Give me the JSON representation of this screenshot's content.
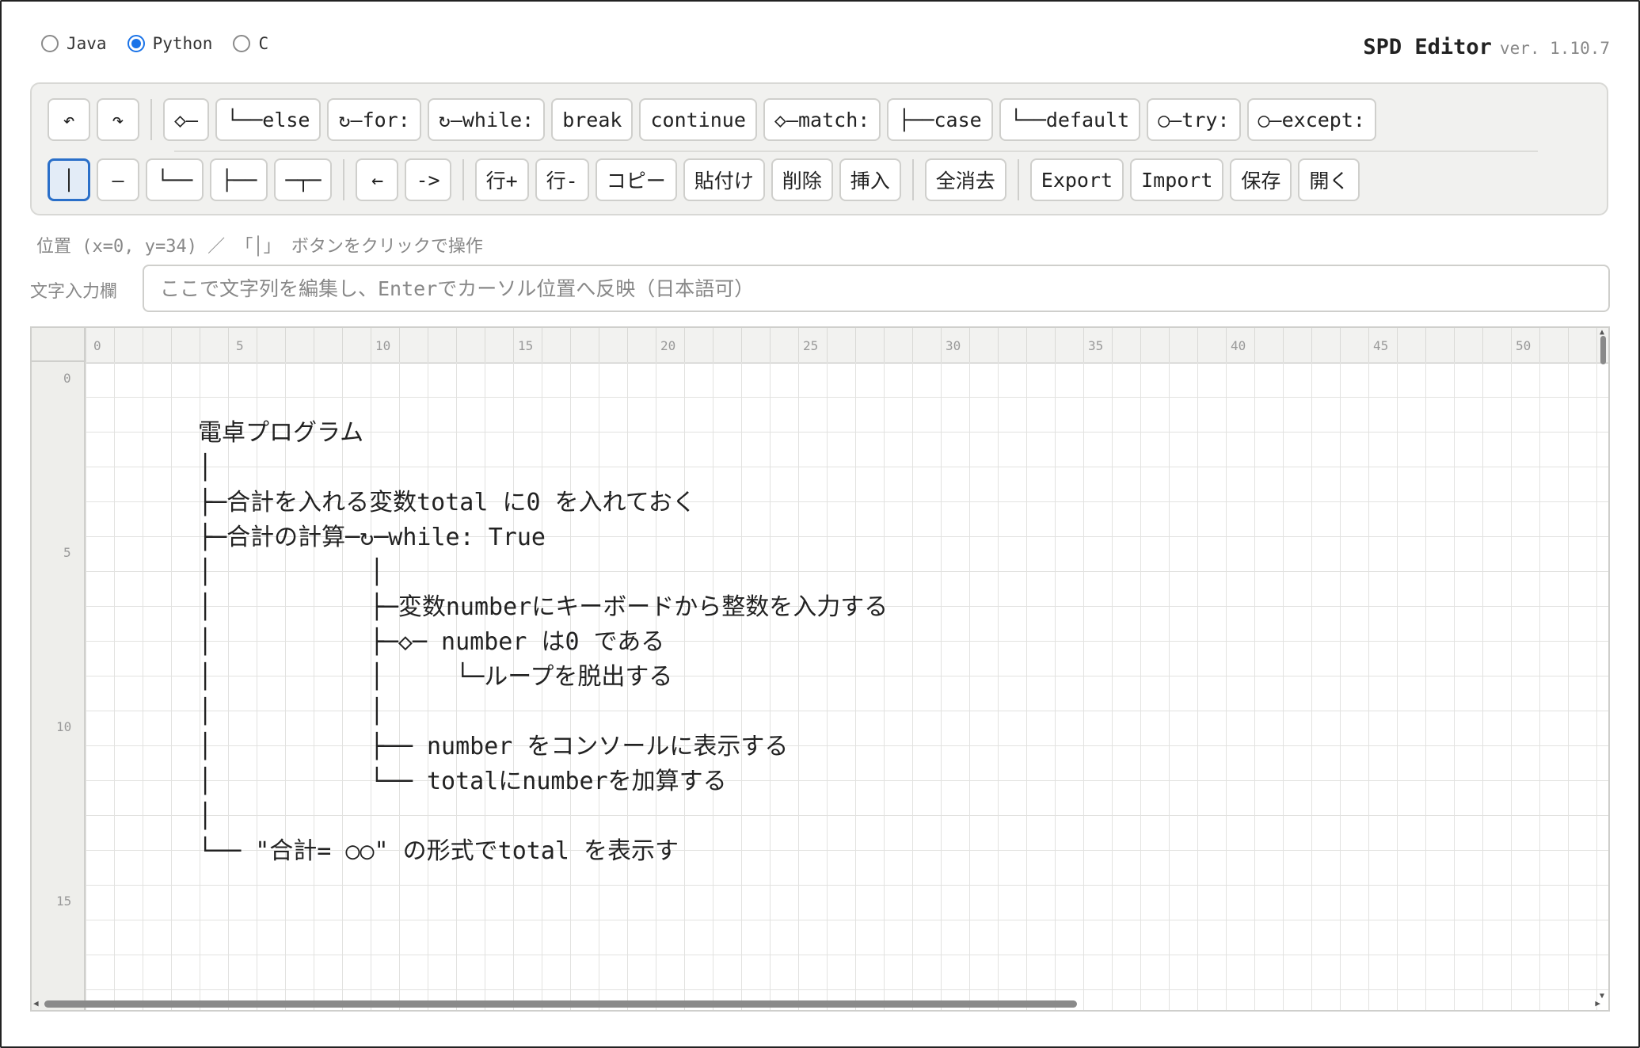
{
  "languages": [
    {
      "label": "Java",
      "selected": false
    },
    {
      "label": "Python",
      "selected": true
    },
    {
      "label": "C",
      "selected": false
    }
  ],
  "app": {
    "title": "SPD Editor",
    "version": "ver. 1.10.7"
  },
  "toolbar": {
    "undo_label": "↶",
    "redo_label": "↷",
    "if_label": "◇―",
    "else_label": "└──else",
    "for_label": "↻―for:",
    "while_label": "↻―while:",
    "break_label": "break",
    "continue_label": "continue",
    "match_label": "◇―match:",
    "case_label": "├──case",
    "default_label": "└──default",
    "try_label": "○―try:",
    "except_label": "○―except:",
    "vline_label": "│",
    "hline_label": "―",
    "corner_label": "└──",
    "tee_label": "├──",
    "cross_label": "─┬─",
    "left_label": "←",
    "right_label": "->",
    "row_add_label": "行+",
    "row_del_label": "行-",
    "copy_label": "コピー",
    "paste_label": "貼付け",
    "delete_label": "削除",
    "insert_label": "挿入",
    "clear_all_label": "全消去",
    "export_label": "Export",
    "import_label": "Import",
    "save_label": "保存",
    "open_label": "開く"
  },
  "status": {
    "hint": "位置 (x=0, y=34) ／ 「│」 ボタンをクリックで操作"
  },
  "text_input": {
    "label": "文字入力欄",
    "placeholder": "ここで文字列を編集し、Enterでカーソル位置へ反映（日本語可）",
    "value": ""
  },
  "ruler": {
    "columns": [
      "0",
      "5",
      "10",
      "15",
      "20",
      "25",
      "30",
      "35",
      "40",
      "45",
      "50"
    ],
    "rows": [
      "0",
      "5",
      "10",
      "15"
    ]
  },
  "editor": {
    "content": "電卓プログラム\n│\n├─合計を入れる変数total に0 を入れておく\n├─合計の計算─↻─while: True\n│           │\n│           ├─変数numberにキーボードから整数を入力する\n│           ├─◇─ number は0 である\n│           │     └─ループを脱出する\n│           │\n│           ├── number をコンソールに表示する\n│           └── totalにnumberを加算する\n│\n└── \"合計= ○○\" の形式でtotal を表示す"
  }
}
